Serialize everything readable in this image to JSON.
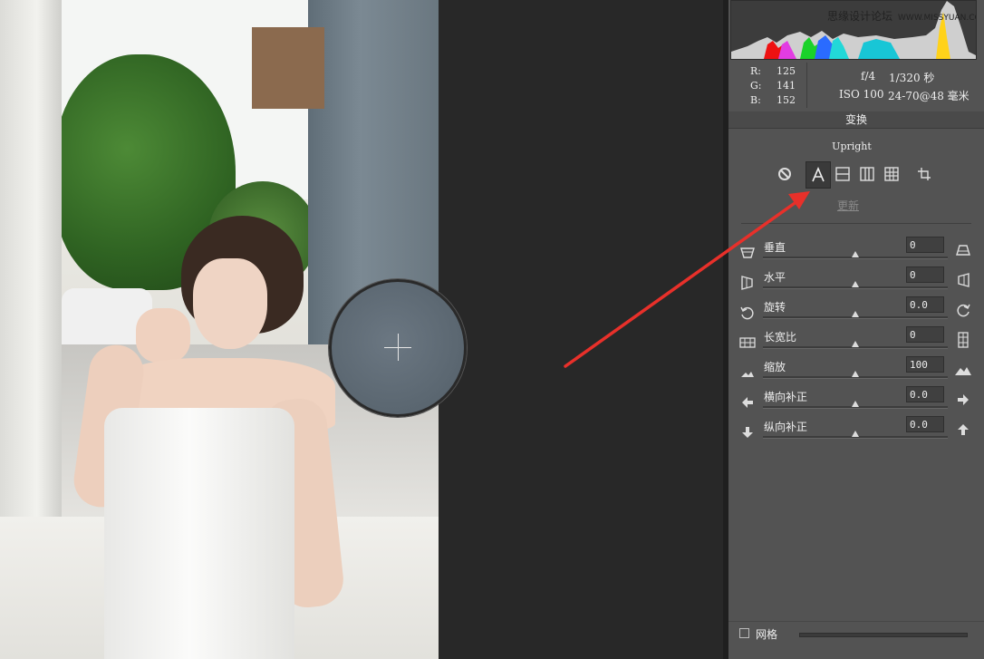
{
  "info": {
    "r_label": "R:",
    "r_value": "125",
    "g_label": "G:",
    "g_value": "141",
    "b_label": "B:",
    "b_value": "152",
    "aperture": "f/4",
    "shutter": "1/320 秒",
    "iso": "ISO 100",
    "lens": "24-70@48 毫米"
  },
  "watermark": {
    "site_cn": "思缘设计论坛",
    "site_url": "WWW.MISSYUAN.COM"
  },
  "section_title": "变换",
  "upright": {
    "label": "Upright",
    "buttons": [
      "off-icon",
      "auto-a-icon",
      "level-icon",
      "vertical-icon",
      "full-grid-icon",
      "guided-icon"
    ],
    "active_button": "auto-a-icon",
    "update_label": "更新"
  },
  "sliders": [
    {
      "label": "垂直",
      "value": "0",
      "position": 0.5
    },
    {
      "label": "水平",
      "value": "0",
      "position": 0.5
    },
    {
      "label": "旋转",
      "value": "0.0",
      "position": 0.5
    },
    {
      "label": "长宽比",
      "value": "0",
      "position": 0.5
    },
    {
      "label": "缩放",
      "value": "100",
      "position": 0.5
    },
    {
      "label": "横向补正",
      "value": "0.0",
      "position": 0.5
    },
    {
      "label": "纵向补正",
      "value": "0.0",
      "position": 0.5
    }
  ],
  "grid": {
    "label": "网格",
    "checked": false
  },
  "colors": {
    "panel_bg": "#535353",
    "arrow": "#e8302a",
    "canvas_bg": "#282828"
  }
}
